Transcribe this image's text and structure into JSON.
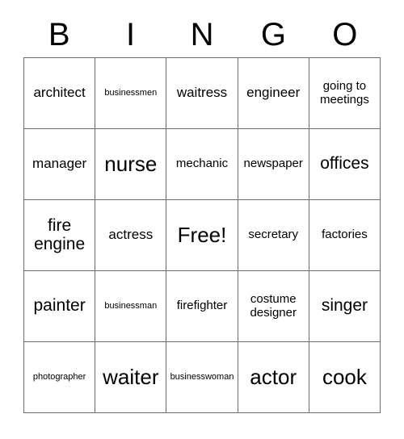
{
  "card": {
    "header_letters": [
      "B",
      "I",
      "N",
      "G",
      "O"
    ],
    "rows": [
      [
        {
          "text": "architect",
          "size": "sz-m"
        },
        {
          "text": "businessmen",
          "size": "sz-xs"
        },
        {
          "text": "waitress",
          "size": "sz-m"
        },
        {
          "text": "engineer",
          "size": "sz-m"
        },
        {
          "text": "going to meetings",
          "size": "sz-s"
        }
      ],
      [
        {
          "text": "manager",
          "size": "sz-m"
        },
        {
          "text": "nurse",
          "size": "sz-xl"
        },
        {
          "text": "mechanic",
          "size": "sz-s"
        },
        {
          "text": "newspaper",
          "size": "sz-s"
        },
        {
          "text": "offices",
          "size": "sz-l"
        }
      ],
      [
        {
          "text": "fire engine",
          "size": "sz-l"
        },
        {
          "text": "actress",
          "size": "sz-m"
        },
        {
          "text": "Free!",
          "size": "sz-xl"
        },
        {
          "text": "secretary",
          "size": "sz-s"
        },
        {
          "text": "factories",
          "size": "sz-s"
        }
      ],
      [
        {
          "text": "painter",
          "size": "sz-l"
        },
        {
          "text": "businessman",
          "size": "sz-xs"
        },
        {
          "text": "firefighter",
          "size": "sz-s"
        },
        {
          "text": "costume designer",
          "size": "sz-s"
        },
        {
          "text": "singer",
          "size": "sz-l"
        }
      ],
      [
        {
          "text": "photographer",
          "size": "sz-xs"
        },
        {
          "text": "waiter",
          "size": "sz-xl"
        },
        {
          "text": "businesswoman",
          "size": "sz-xs"
        },
        {
          "text": "actor",
          "size": "sz-xl"
        },
        {
          "text": "cook",
          "size": "sz-xl"
        }
      ]
    ]
  },
  "colors": {
    "border": "#6b6b6b",
    "text": "#000000",
    "background": "#ffffff"
  }
}
